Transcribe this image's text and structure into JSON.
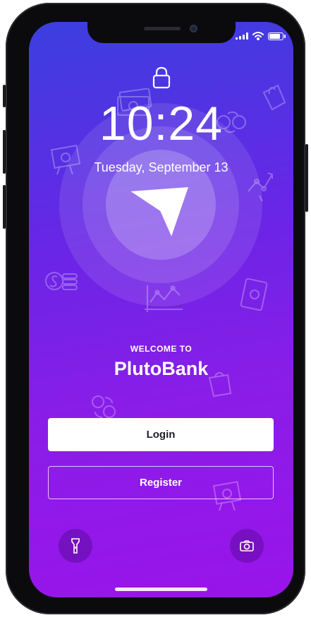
{
  "lock_screen": {
    "time": "10:24",
    "date": "Tuesday, September 13"
  },
  "welcome": {
    "eyebrow": "WELCOME TO",
    "app_name": "PlutoBank"
  },
  "actions": {
    "login_label": "Login",
    "register_label": "Register"
  },
  "shortcuts": [
    "flashlight-icon",
    "camera-icon"
  ],
  "status_bar": [
    "signal-icon",
    "wifi-icon",
    "battery-icon"
  ],
  "colors": {
    "gradient_top": "#3b3fe0",
    "gradient_bottom": "#9a14ea",
    "button_bg": "#ffffff",
    "button_text": "#1e1e2a"
  }
}
